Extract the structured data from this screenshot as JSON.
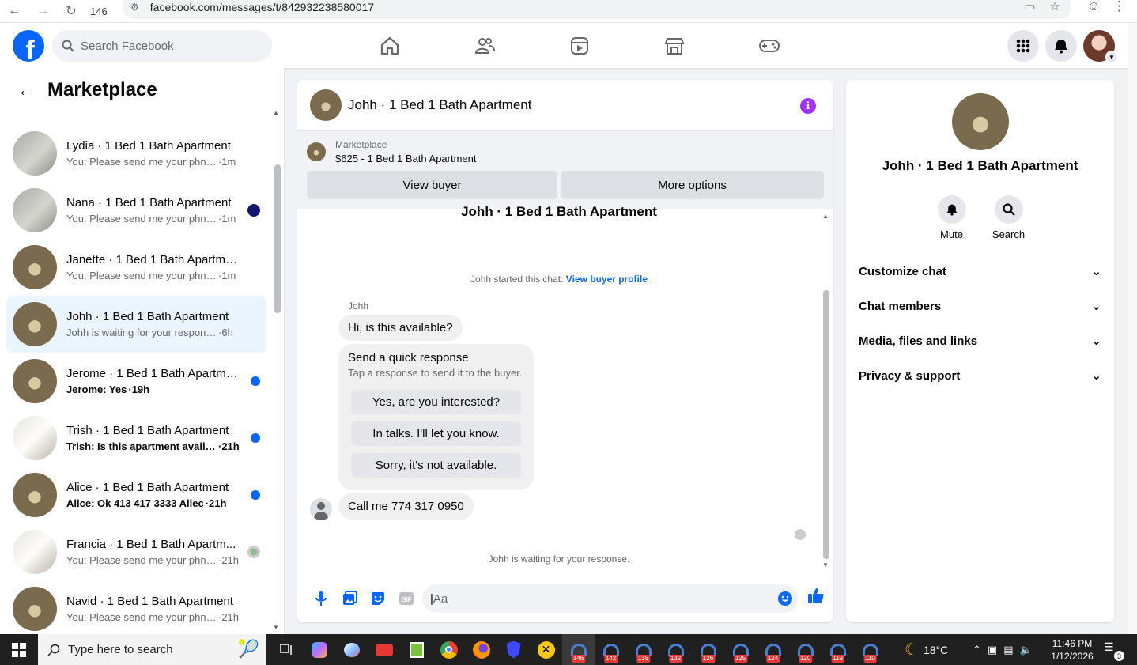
{
  "browser": {
    "tab_count": "146",
    "url": "facebook.com/messages/t/842932238580017"
  },
  "header": {
    "logo": "f",
    "search_placeholder": "Search Facebook"
  },
  "sidebar": {
    "title": "Marketplace",
    "conversations": [
      {
        "name": "Lydia · 1 Bed 1 Bath Apartment",
        "msg": "You: Please send me your phn nu...",
        "time": "·1m",
        "thumb": "grey",
        "unread": false,
        "indicator": "none"
      },
      {
        "name": "Nana · 1 Bed 1 Bath Apartment",
        "msg": "You: Please send me your phn n...",
        "time": "·1m",
        "thumb": "grey",
        "unread": false,
        "indicator": "seen"
      },
      {
        "name": "Janette · 1 Bed 1 Bath Apartment",
        "msg": "You: Please send me your phn nu...",
        "time": "·1m",
        "thumb": "room",
        "unread": false,
        "indicator": "none"
      },
      {
        "name": "Johh · 1 Bed 1 Bath Apartment",
        "msg": "Johh is waiting for your response.",
        "time": "·6h",
        "thumb": "room",
        "unread": false,
        "indicator": "none"
      },
      {
        "name": "Jerome · 1 Bed 1 Bath Apartment",
        "msg": "Jerome: Yes",
        "time": "·19h",
        "thumb": "room",
        "unread": true,
        "indicator": "dot"
      },
      {
        "name": "Trish · 1 Bed 1 Bath Apartment",
        "msg": "Trish: Is this apartment availabl...",
        "time": "·21h",
        "thumb": "bed",
        "unread": true,
        "indicator": "dot"
      },
      {
        "name": "Alice · 1 Bed 1 Bath Apartment",
        "msg": "Alice: Ok 413 417 3333 Aliec",
        "time": "·21h",
        "thumb": "room",
        "unread": true,
        "indicator": "dot"
      },
      {
        "name": "Francia · 1 Bed 1 Bath Apartm...",
        "msg": "You: Please send me your phn ...",
        "time": "·21h",
        "thumb": "bed",
        "unread": false,
        "indicator": "avatar"
      },
      {
        "name": "Navid · 1 Bed 1 Bath Apartment",
        "msg": "You: Please send me your phn nu...",
        "time": "·21h",
        "thumb": "room",
        "unread": false,
        "indicator": "none"
      }
    ]
  },
  "chat": {
    "title": "Johh · 1 Bed 1 Bath Apartment",
    "marketplace_label": "Marketplace",
    "listing": "$625 - 1 Bed 1 Bath Apartment",
    "view_buyer": "View buyer",
    "more_options": "More options",
    "topic": "Johh · 1 Bed 1 Bath Apartment",
    "started_text": "Johh started this chat.",
    "view_profile": "View buyer profile",
    "sender": "Johh",
    "msg1": "Hi, is this available?",
    "quick_title": "Send a quick response",
    "quick_sub": "Tap a response to send it to the buyer.",
    "quick_responses": [
      "Yes, are you interested?",
      "In talks. I'll let you know.",
      "Sorry, it's not available."
    ],
    "msg2": "Call me 774 317 0950",
    "waiting": "Johh is waiting for your response.",
    "input_placeholder": "Aa"
  },
  "details": {
    "name": "Johh · 1 Bed 1 Bath Apartment",
    "mute": "Mute",
    "search": "Search",
    "sections": [
      "Customize chat",
      "Chat members",
      "Media, files and links",
      "Privacy & support"
    ]
  },
  "taskbar": {
    "search_placeholder": "Type here to search",
    "app_badges": [
      "146",
      "142",
      "138",
      "132",
      "126",
      "125",
      "124",
      "120",
      "119",
      "110"
    ],
    "weather": "18°C",
    "time": "11:46 PM",
    "date": "1/12/2026",
    "notifications": "3"
  },
  "colors": {
    "fb_blue": "#0866ff",
    "info_purple": "#a033ff",
    "active_conv": "#ebf5ff"
  }
}
